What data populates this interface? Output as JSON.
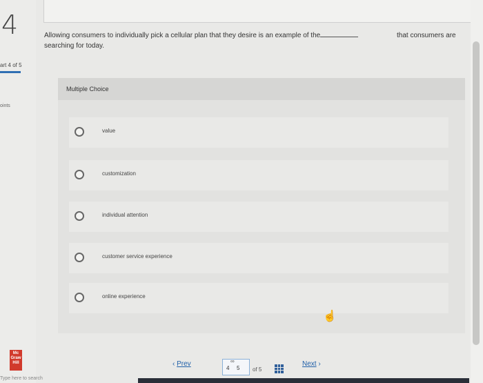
{
  "sidebar": {
    "question_number": "4",
    "part_text": "art 4 of 5",
    "points_text": "oints",
    "logo_text": "Mc Graw Hill",
    "search_hint": "Type here to search"
  },
  "question": {
    "text": "Allowing consumers to individually pick a cellular plan that they desire is an example of the",
    "tail": "that consumers are",
    "continuation": "searching for today."
  },
  "multiple_choice": {
    "header": "Multiple Choice",
    "options": [
      {
        "label": "value"
      },
      {
        "label": "customization"
      },
      {
        "label": "individual attention"
      },
      {
        "label": "customer service experience"
      },
      {
        "label": "online experience"
      }
    ]
  },
  "footer": {
    "prev_label": "Prev",
    "current_page": "4",
    "next_page": "5",
    "of_total": "of 5",
    "next_label": "Next"
  }
}
